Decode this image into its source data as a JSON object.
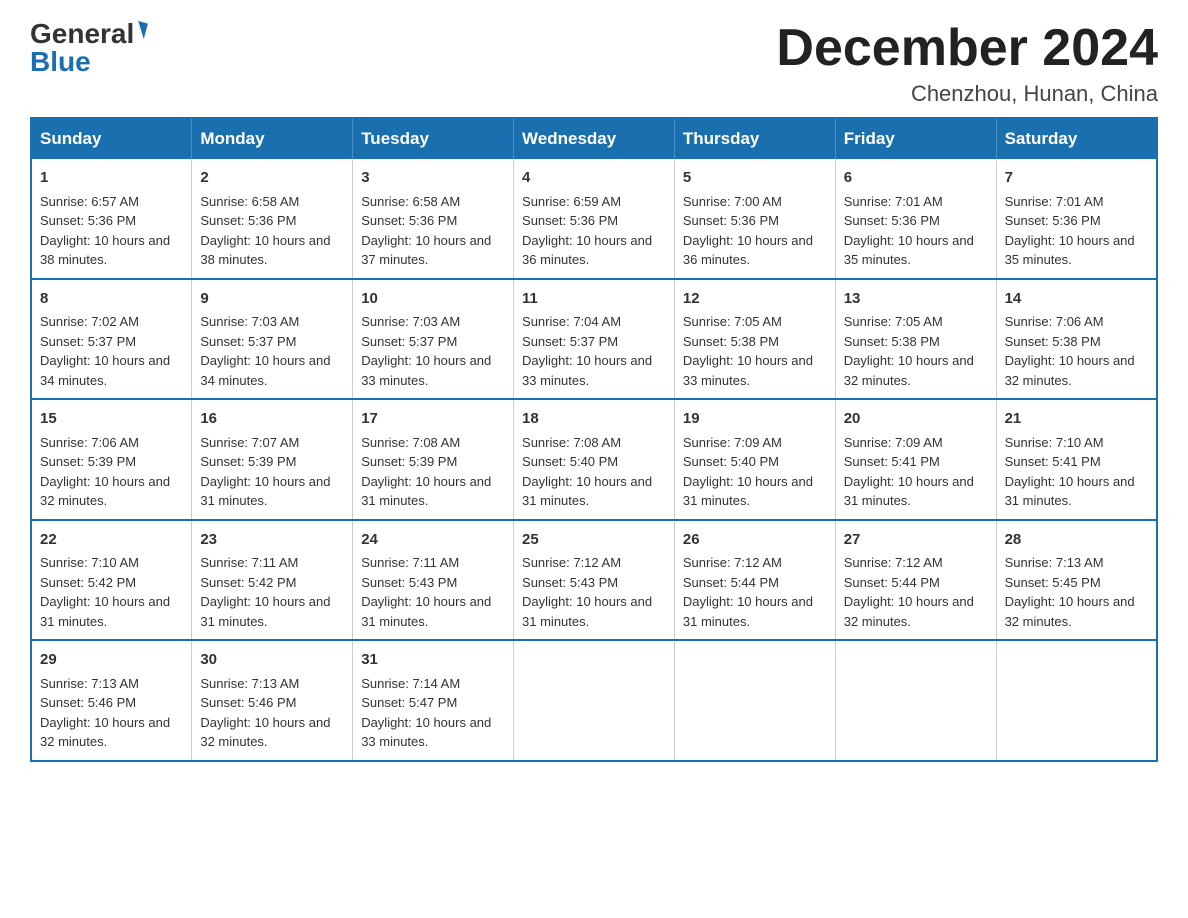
{
  "logo": {
    "general": "General",
    "blue": "Blue"
  },
  "title": "December 2024",
  "location": "Chenzhou, Hunan, China",
  "weekdays": [
    "Sunday",
    "Monday",
    "Tuesday",
    "Wednesday",
    "Thursday",
    "Friday",
    "Saturday"
  ],
  "weeks": [
    [
      {
        "day": "1",
        "sunrise": "6:57 AM",
        "sunset": "5:36 PM",
        "daylight": "10 hours and 38 minutes."
      },
      {
        "day": "2",
        "sunrise": "6:58 AM",
        "sunset": "5:36 PM",
        "daylight": "10 hours and 38 minutes."
      },
      {
        "day": "3",
        "sunrise": "6:58 AM",
        "sunset": "5:36 PM",
        "daylight": "10 hours and 37 minutes."
      },
      {
        "day": "4",
        "sunrise": "6:59 AM",
        "sunset": "5:36 PM",
        "daylight": "10 hours and 36 minutes."
      },
      {
        "day": "5",
        "sunrise": "7:00 AM",
        "sunset": "5:36 PM",
        "daylight": "10 hours and 36 minutes."
      },
      {
        "day": "6",
        "sunrise": "7:01 AM",
        "sunset": "5:36 PM",
        "daylight": "10 hours and 35 minutes."
      },
      {
        "day": "7",
        "sunrise": "7:01 AM",
        "sunset": "5:36 PM",
        "daylight": "10 hours and 35 minutes."
      }
    ],
    [
      {
        "day": "8",
        "sunrise": "7:02 AM",
        "sunset": "5:37 PM",
        "daylight": "10 hours and 34 minutes."
      },
      {
        "day": "9",
        "sunrise": "7:03 AM",
        "sunset": "5:37 PM",
        "daylight": "10 hours and 34 minutes."
      },
      {
        "day": "10",
        "sunrise": "7:03 AM",
        "sunset": "5:37 PM",
        "daylight": "10 hours and 33 minutes."
      },
      {
        "day": "11",
        "sunrise": "7:04 AM",
        "sunset": "5:37 PM",
        "daylight": "10 hours and 33 minutes."
      },
      {
        "day": "12",
        "sunrise": "7:05 AM",
        "sunset": "5:38 PM",
        "daylight": "10 hours and 33 minutes."
      },
      {
        "day": "13",
        "sunrise": "7:05 AM",
        "sunset": "5:38 PM",
        "daylight": "10 hours and 32 minutes."
      },
      {
        "day": "14",
        "sunrise": "7:06 AM",
        "sunset": "5:38 PM",
        "daylight": "10 hours and 32 minutes."
      }
    ],
    [
      {
        "day": "15",
        "sunrise": "7:06 AM",
        "sunset": "5:39 PM",
        "daylight": "10 hours and 32 minutes."
      },
      {
        "day": "16",
        "sunrise": "7:07 AM",
        "sunset": "5:39 PM",
        "daylight": "10 hours and 31 minutes."
      },
      {
        "day": "17",
        "sunrise": "7:08 AM",
        "sunset": "5:39 PM",
        "daylight": "10 hours and 31 minutes."
      },
      {
        "day": "18",
        "sunrise": "7:08 AM",
        "sunset": "5:40 PM",
        "daylight": "10 hours and 31 minutes."
      },
      {
        "day": "19",
        "sunrise": "7:09 AM",
        "sunset": "5:40 PM",
        "daylight": "10 hours and 31 minutes."
      },
      {
        "day": "20",
        "sunrise": "7:09 AM",
        "sunset": "5:41 PM",
        "daylight": "10 hours and 31 minutes."
      },
      {
        "day": "21",
        "sunrise": "7:10 AM",
        "sunset": "5:41 PM",
        "daylight": "10 hours and 31 minutes."
      }
    ],
    [
      {
        "day": "22",
        "sunrise": "7:10 AM",
        "sunset": "5:42 PM",
        "daylight": "10 hours and 31 minutes."
      },
      {
        "day": "23",
        "sunrise": "7:11 AM",
        "sunset": "5:42 PM",
        "daylight": "10 hours and 31 minutes."
      },
      {
        "day": "24",
        "sunrise": "7:11 AM",
        "sunset": "5:43 PM",
        "daylight": "10 hours and 31 minutes."
      },
      {
        "day": "25",
        "sunrise": "7:12 AM",
        "sunset": "5:43 PM",
        "daylight": "10 hours and 31 minutes."
      },
      {
        "day": "26",
        "sunrise": "7:12 AM",
        "sunset": "5:44 PM",
        "daylight": "10 hours and 31 minutes."
      },
      {
        "day": "27",
        "sunrise": "7:12 AM",
        "sunset": "5:44 PM",
        "daylight": "10 hours and 32 minutes."
      },
      {
        "day": "28",
        "sunrise": "7:13 AM",
        "sunset": "5:45 PM",
        "daylight": "10 hours and 32 minutes."
      }
    ],
    [
      {
        "day": "29",
        "sunrise": "7:13 AM",
        "sunset": "5:46 PM",
        "daylight": "10 hours and 32 minutes."
      },
      {
        "day": "30",
        "sunrise": "7:13 AM",
        "sunset": "5:46 PM",
        "daylight": "10 hours and 32 minutes."
      },
      {
        "day": "31",
        "sunrise": "7:14 AM",
        "sunset": "5:47 PM",
        "daylight": "10 hours and 33 minutes."
      },
      null,
      null,
      null,
      null
    ]
  ]
}
